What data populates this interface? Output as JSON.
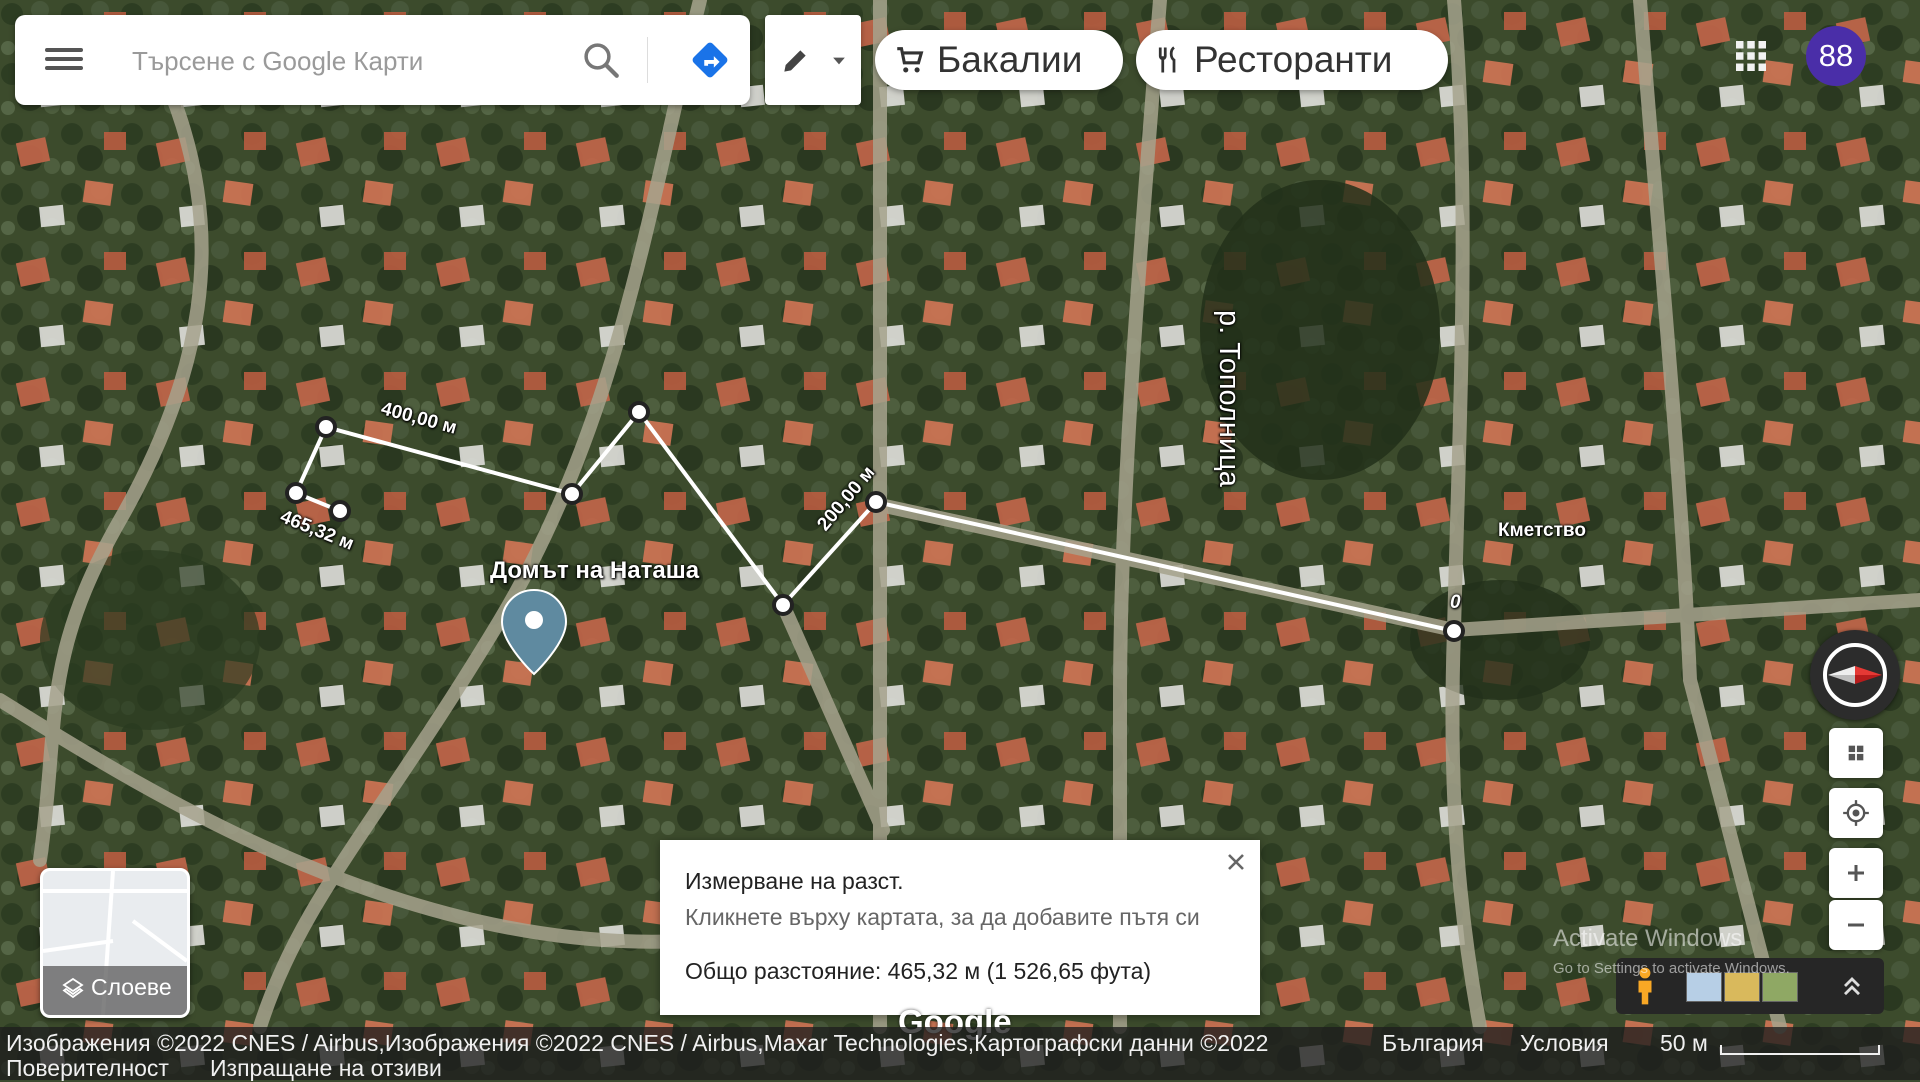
{
  "search": {
    "placeholder": "Търсене с Google Карти"
  },
  "chips": [
    {
      "label": "Бакалии"
    },
    {
      "label": "Ресторанти"
    }
  ],
  "account": {
    "avatar_text": "88"
  },
  "map_labels": {
    "home": "Домът на Наташа",
    "river": "р. Тополница",
    "mayor": "Кметство"
  },
  "measure": {
    "segments": [
      {
        "label": "400,00 м"
      },
      {
        "label": "465,32 м"
      },
      {
        "label": "200,00 м"
      },
      {
        "label": "0"
      }
    ],
    "panel": {
      "title": "Измерване на разст.",
      "hint": "Кликнете върху картата, за да добавите пътя си",
      "total": "Общо разстояние: 465,32 м (1 526,65 фута)"
    }
  },
  "layers": {
    "label": "Слоеве"
  },
  "footer": {
    "attribution": "Изображения ©2022 CNES / Airbus,Изображения ©2022 CNES / Airbus,Maxar Technologies,Картографски данни ©2022",
    "country": "България",
    "terms": "Условия",
    "scale": "50 м",
    "privacy": "Поверителност",
    "feedback": "Изпращане на отзиви"
  },
  "watermark": {
    "line1": "Activate Windows",
    "line2": "Go to Settings to activate Windows."
  },
  "logo": "Google",
  "icons": [
    "menu-icon",
    "search-icon",
    "directions-icon",
    "pencil-icon",
    "dropdown-icon",
    "cart-icon",
    "restaurant-icon",
    "apps-icon",
    "map-pin-icon",
    "close-icon",
    "layers-icon",
    "compass-icon",
    "grid-icon",
    "my-location-icon",
    "zoom-in-icon",
    "zoom-out-icon",
    "pegman-icon",
    "expand-icon"
  ],
  "colors": {
    "accent": "#1a73e8",
    "avatar_bg": "#4a2ea8",
    "compass_red": "#e53935",
    "pin": "#5f8aa0"
  }
}
